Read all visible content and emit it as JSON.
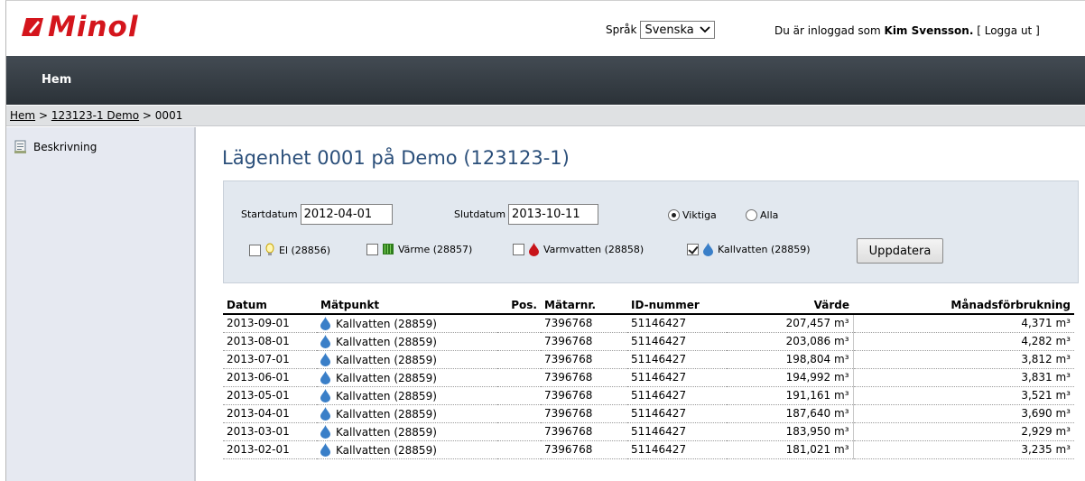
{
  "header": {
    "brand": "Minol",
    "language_label": "Språk",
    "language_selected": "Svenska",
    "login_prefix": "Du är inloggad som",
    "user_name": "Kim Svensson.",
    "logout_open": "[",
    "logout_label": "Logga ut",
    "logout_close": "]"
  },
  "nav": {
    "home": "Hem"
  },
  "breadcrumb": {
    "home": "Hem",
    "sep1": ">",
    "property": "123123-1 Demo",
    "sep2": ">",
    "current": "0001"
  },
  "sidebar": {
    "items": [
      {
        "label": "Beskrivning",
        "icon": "document-icon"
      }
    ]
  },
  "page": {
    "title": "Lägenhet 0001 på Demo (123123-1)"
  },
  "filter": {
    "start_label": "Startdatum",
    "start_value": "2012-04-01",
    "end_label": "Slutdatum",
    "end_value": "2013-10-11",
    "radio_important": "Viktiga",
    "radio_all": "Alla",
    "radio_selected": "Viktiga",
    "meters": [
      {
        "label": "El (28856)",
        "checked": false,
        "icon": "bulb-icon"
      },
      {
        "label": "Värme (28857)",
        "checked": false,
        "icon": "radiator-icon"
      },
      {
        "label": "Varmvatten (28858)",
        "checked": false,
        "icon": "red-drop-icon"
      },
      {
        "label": "Kallvatten (28859)",
        "checked": true,
        "icon": "blue-drop-icon"
      }
    ],
    "update_button": "Uppdatera"
  },
  "table": {
    "headers": [
      "Datum",
      "Mätpunkt",
      "Pos.",
      "Mätarnr.",
      "ID-nummer",
      "Värde",
      "Månadsförbrukning"
    ],
    "rows": [
      [
        "2013-09-01",
        "Kallvatten (28859)",
        "",
        "7396768",
        "51146427",
        "207,457 m³",
        "4,371 m³"
      ],
      [
        "2013-08-01",
        "Kallvatten (28859)",
        "",
        "7396768",
        "51146427",
        "203,086 m³",
        "4,282 m³"
      ],
      [
        "2013-07-01",
        "Kallvatten (28859)",
        "",
        "7396768",
        "51146427",
        "198,804 m³",
        "3,812 m³"
      ],
      [
        "2013-06-01",
        "Kallvatten (28859)",
        "",
        "7396768",
        "51146427",
        "194,992 m³",
        "3,831 m³"
      ],
      [
        "2013-05-01",
        "Kallvatten (28859)",
        "",
        "7396768",
        "51146427",
        "191,161 m³",
        "3,521 m³"
      ],
      [
        "2013-04-01",
        "Kallvatten (28859)",
        "",
        "7396768",
        "51146427",
        "187,640 m³",
        "3,690 m³"
      ],
      [
        "2013-03-01",
        "Kallvatten (28859)",
        "",
        "7396768",
        "51146427",
        "183,950 m³",
        "2,929 m³"
      ],
      [
        "2013-02-01",
        "Kallvatten (28859)",
        "",
        "7396768",
        "51146427",
        "181,021 m³",
        "3,235 m³"
      ]
    ]
  },
  "colors": {
    "brand_red": "#d4151c",
    "navbar": "#343b42",
    "title_blue": "#2b4f7a",
    "filter_bg": "#e2e8ef",
    "sidebar_bg": "#e6e9f1"
  }
}
